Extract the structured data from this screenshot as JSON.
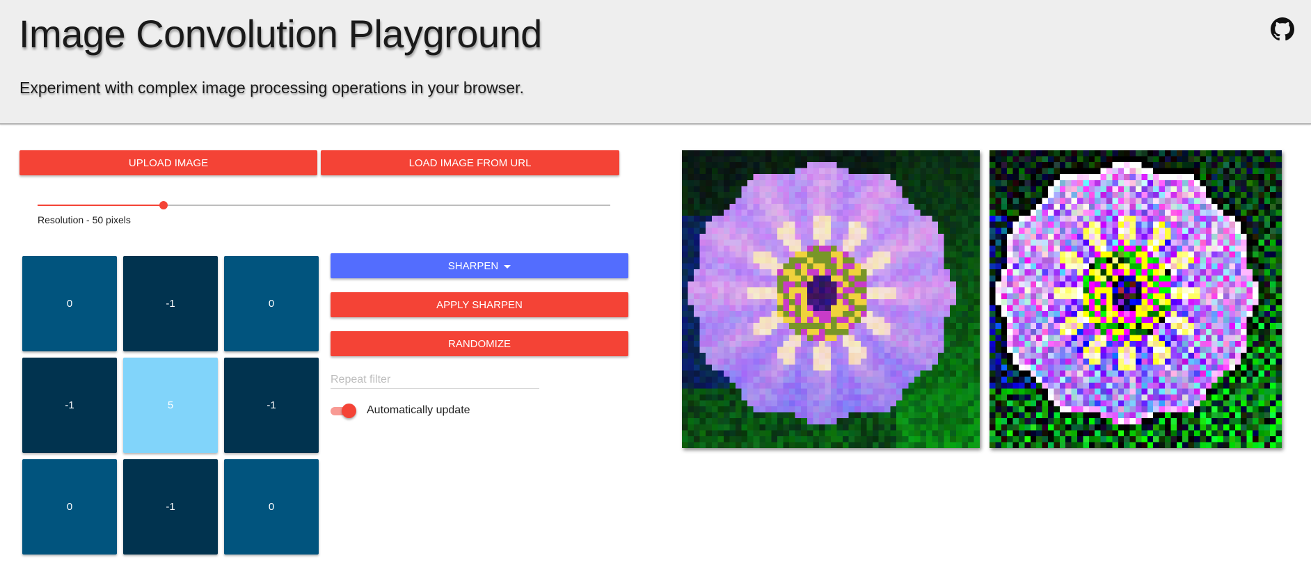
{
  "header": {
    "title": "Image Convolution Playground",
    "subtitle": "Experiment with complex image processing operations in your browser.",
    "github_icon": "github-icon"
  },
  "controls": {
    "upload_label": "UPLOAD IMAGE",
    "load_url_label": "LOAD IMAGE FROM URL",
    "resolution": {
      "value": 50,
      "fraction": 0.22,
      "label": "Resolution - 50 pixels"
    }
  },
  "kernel": {
    "cells": [
      {
        "value": "0",
        "color": "#01547e"
      },
      {
        "value": "-1",
        "color": "#01334f"
      },
      {
        "value": "0",
        "color": "#01547e"
      },
      {
        "value": "-1",
        "color": "#01334f"
      },
      {
        "value": "5",
        "color": "#81d4fa"
      },
      {
        "value": "-1",
        "color": "#01334f"
      },
      {
        "value": "0",
        "color": "#01547e"
      },
      {
        "value": "-1",
        "color": "#01334f"
      },
      {
        "value": "0",
        "color": "#01547e"
      }
    ]
  },
  "filter": {
    "selected": "SHARPEN",
    "dropdown_icon": "caret-down-icon",
    "apply_label": "APPLY SHARPEN",
    "randomize_label": "RANDOMIZE",
    "repeat_placeholder": "Repeat filter",
    "repeat_value": "",
    "auto_update_label": "Automatically update",
    "auto_update_on": true
  },
  "images": {
    "original_alt": "Original flower image (pixelated)",
    "filtered_alt": "Sharpened flower image (pixelated)"
  },
  "colors": {
    "accent_red": "#f44336",
    "accent_blue": "#536dfe",
    "header_bg": "#eeeeee"
  }
}
